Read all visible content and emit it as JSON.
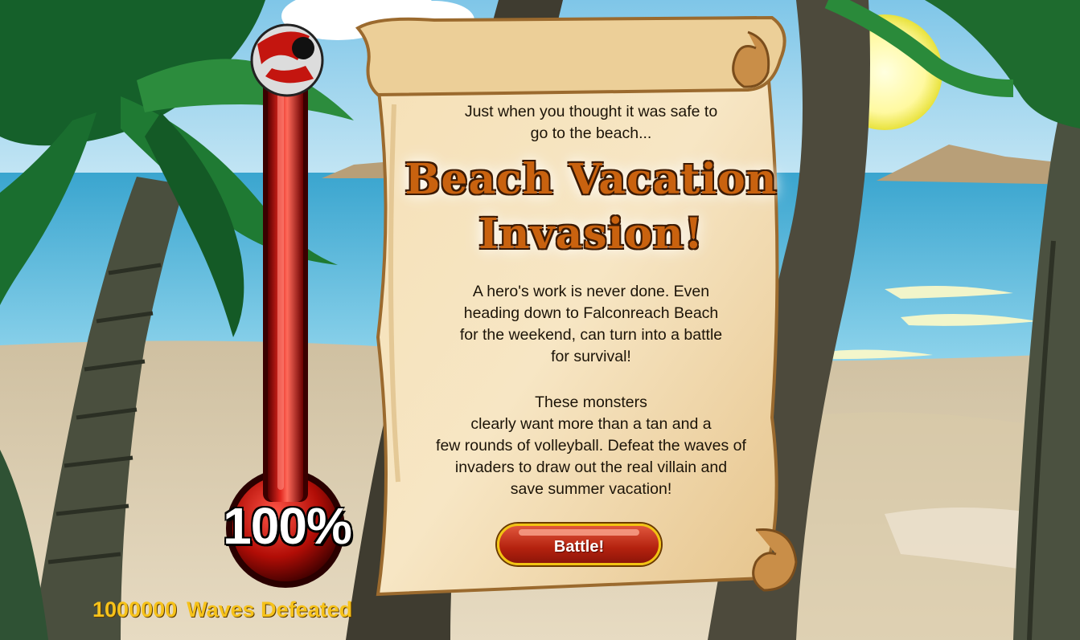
{
  "event": {
    "intro": [
      "Just when you thought it was safe to",
      "go to the beach..."
    ],
    "title_line1": "Beach Vacation",
    "title_line2": "Invasion!",
    "body1": [
      "A hero's work is never done. Even",
      "heading down to Falconreach Beach",
      "for the weekend, can turn into a battle",
      "for survival!"
    ],
    "body2": [
      "These monsters",
      "clearly want more than a tan and a",
      "few rounds of volleyball. Defeat the waves of",
      "invaders to draw out the real villain and",
      "save summer vacation!"
    ],
    "battle_label": "Battle!"
  },
  "progress": {
    "percent_label": "100%",
    "fraction": 1.0,
    "waves_count": "1000000",
    "waves_label": "Waves Defeated"
  },
  "icons": {
    "thermometer_cap": "beach-ball-icon"
  },
  "colors": {
    "thermo_red": "#c4150f",
    "gold_text": "#f6c21a",
    "title_orange": "#c9620f",
    "parchment": "#f1d7a8"
  }
}
